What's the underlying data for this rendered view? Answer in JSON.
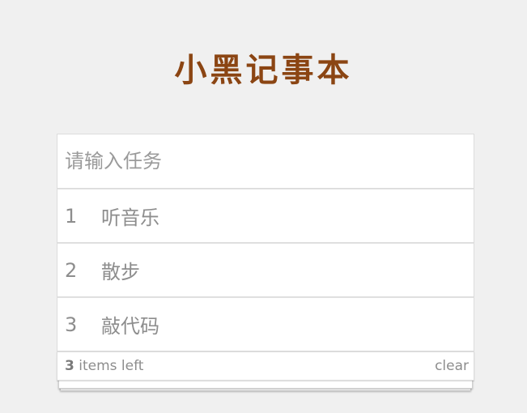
{
  "app": {
    "title": "小黑记事本"
  },
  "input": {
    "placeholder": "请输入任务",
    "value": ""
  },
  "todos": [
    {
      "index": "1",
      "text": "听音乐"
    },
    {
      "index": "2",
      "text": "散步"
    },
    {
      "index": "3",
      "text": "敲代码"
    }
  ],
  "footer": {
    "count": "3",
    "count_suffix": " items left",
    "clear_label": "clear"
  },
  "colors": {
    "title": "#8b4513",
    "background": "#f0f0f0",
    "text": "#8d8d8d"
  }
}
